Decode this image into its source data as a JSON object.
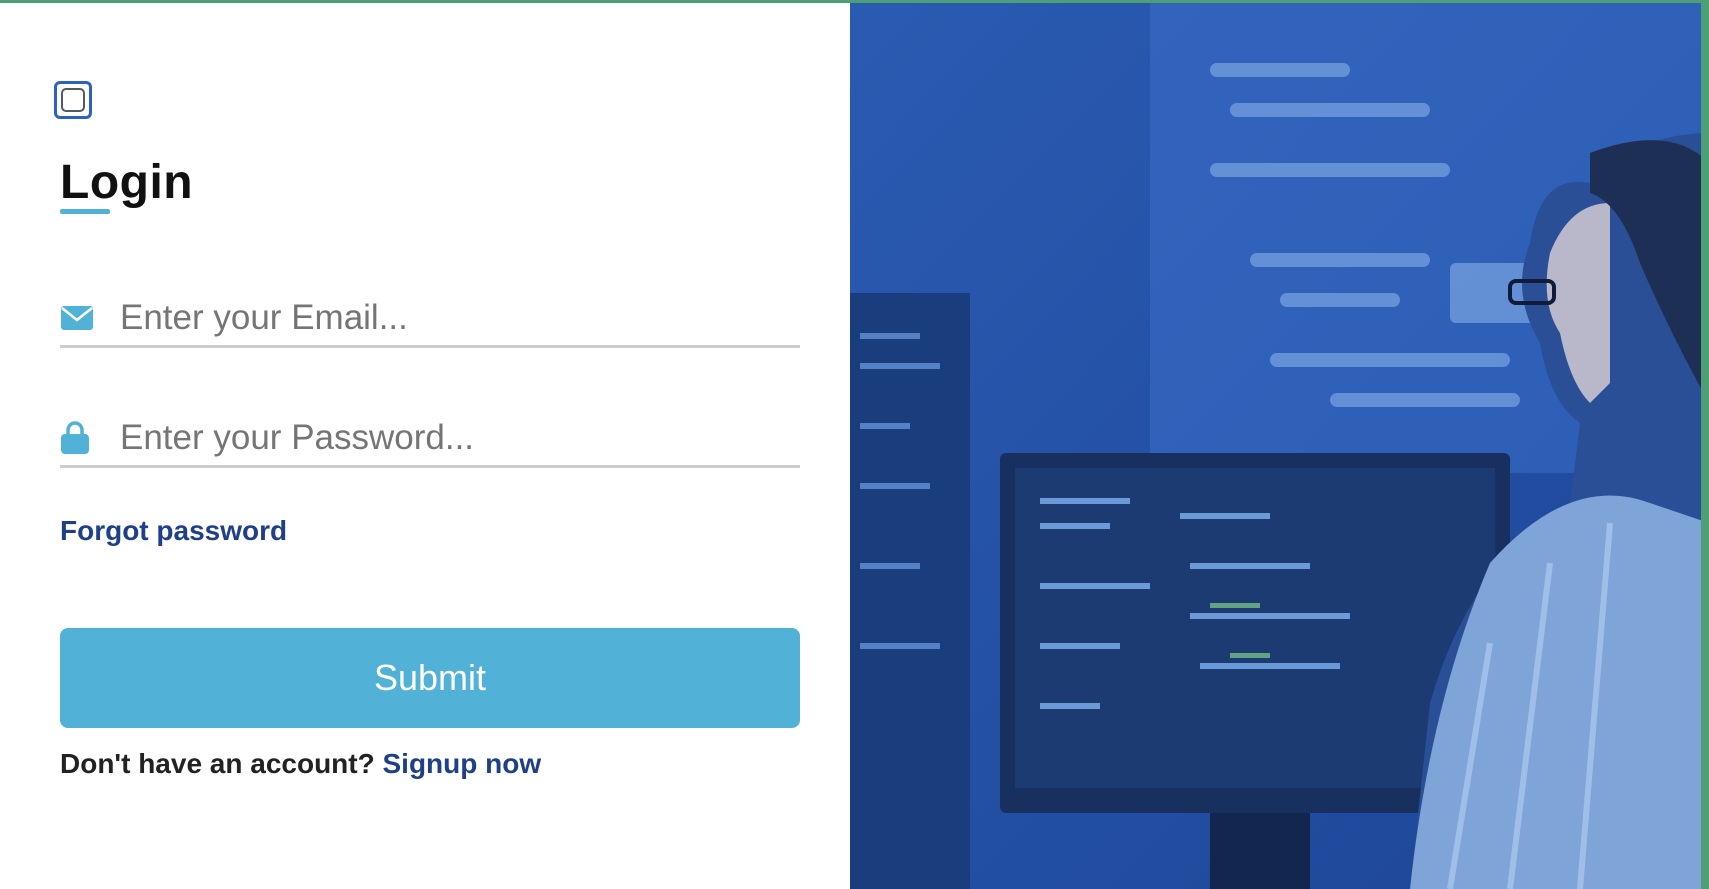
{
  "login": {
    "title": "Login",
    "email_placeholder": "Enter your Email...",
    "password_placeholder": "Enter your Password...",
    "forgot_label": "Forgot password",
    "submit_label": "Submit",
    "signup_prompt": "Don't have an account?",
    "signup_link": "Signup now"
  },
  "icons": {
    "email": "envelope-icon",
    "password": "lock-icon",
    "toggle": "checkbox-icon"
  },
  "colors": {
    "accent": "#52b1d7",
    "link": "#1f3f86",
    "toggle_border": "#2c62c0",
    "image_tint": "#234fa8"
  }
}
